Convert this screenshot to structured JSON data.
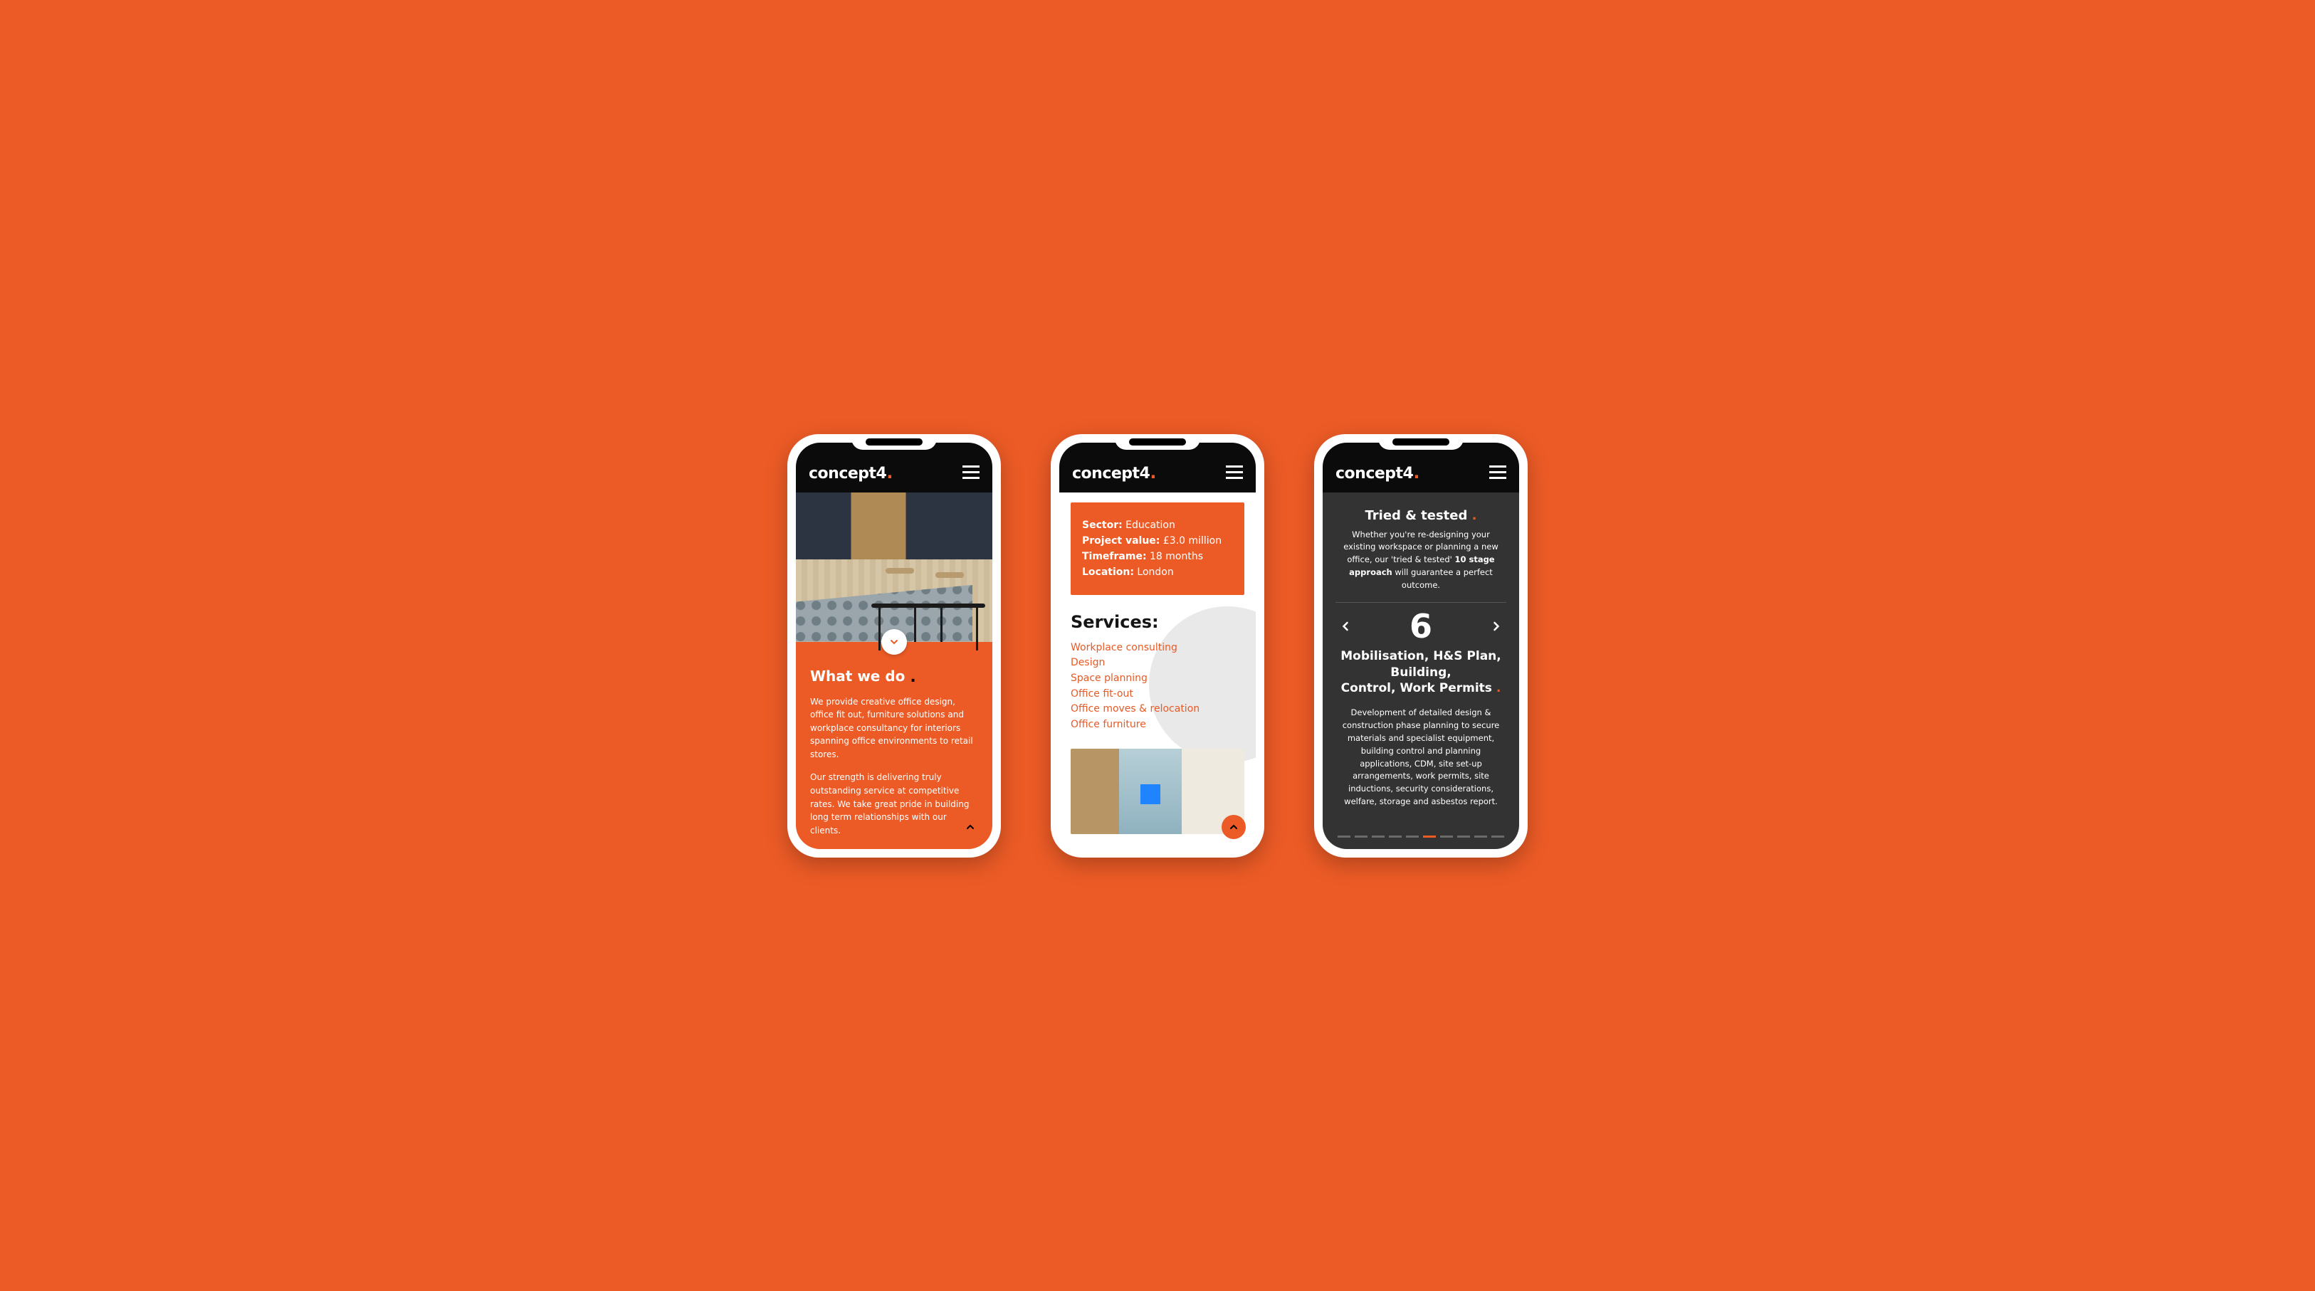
{
  "brand": {
    "name": "concept4",
    "dot": "."
  },
  "phone1": {
    "heading": "What we do",
    "p1": "We provide creative office design, office fit out, furniture solutions and workplace consultancy for interiors spanning office environments to retail stores.",
    "p2": "Our strength is delivering truly outstanding service at competitive rates. We take great pride in building long term relationships with our clients."
  },
  "phone2": {
    "info": {
      "sector_label": "Sector:",
      "sector": "Education",
      "value_label": "Project value:",
      "value": "£3.0 million",
      "time_label": "Timeframe:",
      "time": "18 months",
      "loc_label": "Location:",
      "loc": "London"
    },
    "services_heading": "Services:",
    "services": [
      "Workplace consulting",
      "Design",
      "Space planning",
      "Office fit-out",
      "Office moves & relocation",
      "Office furniture"
    ]
  },
  "phone3": {
    "title": "Tried & tested",
    "lead_pre": "Whether you're re-designing your existing workspace or planning a new office, our 'tried & tested' ",
    "lead_bold": "10 stage approach",
    "lead_post": " will guarantee a perfect outcome.",
    "stage_number": "6",
    "stage_line1": "Mobilisation, H&S Plan, Building,",
    "stage_line2": "Control, Work Permits",
    "desc": "Development of detailed design & construction phase planning to secure materials and specialist equipment, building control and planning applications, CDM, site set-up arrangements, work permits, site inductions, security considerations, welfare, storage and asbestos report.",
    "total_stages": 10,
    "active_index": 6
  }
}
